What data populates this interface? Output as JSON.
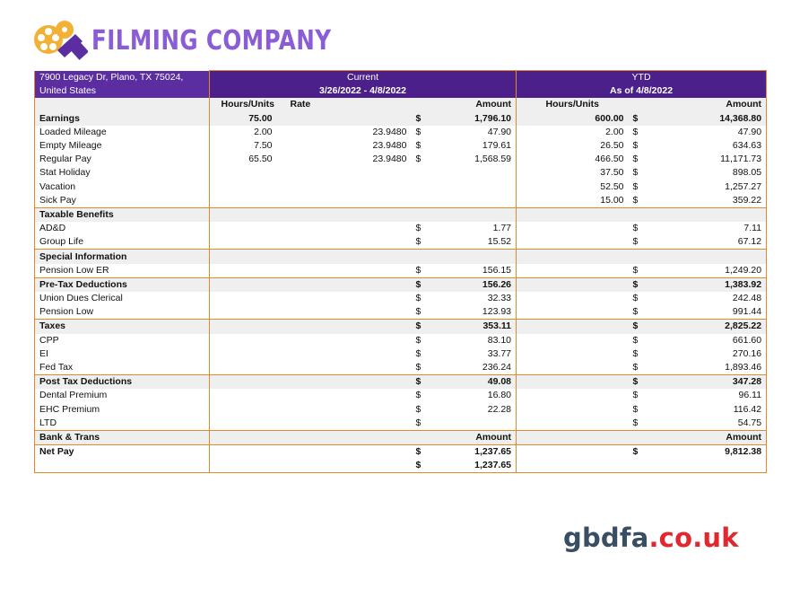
{
  "brand": {
    "name": "FILMING COMPANY",
    "color": "#8a5cd6",
    "icon": "film-reel-icon"
  },
  "header": {
    "address": "7900  Legacy Dr, Plano, TX 75024, United States",
    "current_label": "Current",
    "current_period": "3/26/2022  - 4/8/2022",
    "ytd_label": "YTD",
    "ytd_period": "As of 4/8/2022"
  },
  "columns": [
    "Hours/Units",
    "Rate",
    "Amount",
    "Hours/Units",
    "Amount"
  ],
  "rows": [
    {
      "label": "Earnings",
      "hours": "75.00",
      "rate": "",
      "cur_dollar": "$",
      "cur_amount": "1,796.10",
      "ytd_hours": "600.00",
      "ytd_dollar": "$",
      "ytd_amount": "14,368.80",
      "bold": true,
      "grey": true
    },
    {
      "label": "Loaded Mileage",
      "hours": "2.00",
      "rate": "23.9480",
      "cur_dollar": "$",
      "cur_amount": "47.90",
      "ytd_hours": "2.00",
      "ytd_dollar": "$",
      "ytd_amount": "47.90"
    },
    {
      "label": "Empty Mileage",
      "hours": "7.50",
      "rate": "23.9480",
      "cur_dollar": "$",
      "cur_amount": "179.61",
      "ytd_hours": "26.50",
      "ytd_dollar": "$",
      "ytd_amount": "634.63"
    },
    {
      "label": "Regular Pay",
      "hours": "65.50",
      "rate": "23.9480",
      "cur_dollar": "$",
      "cur_amount": "1,568.59",
      "ytd_hours": "466.50",
      "ytd_dollar": "$",
      "ytd_amount": "11,171.73"
    },
    {
      "label": "Stat Holiday",
      "hours": "",
      "rate": "",
      "cur_dollar": "",
      "cur_amount": "",
      "ytd_hours": "37.50",
      "ytd_dollar": "$",
      "ytd_amount": "898.05"
    },
    {
      "label": "Vacation",
      "hours": "",
      "rate": "",
      "cur_dollar": "",
      "cur_amount": "",
      "ytd_hours": "52.50",
      "ytd_dollar": "$",
      "ytd_amount": "1,257.27"
    },
    {
      "label": "Sick Pay",
      "hours": "",
      "rate": "",
      "cur_dollar": "",
      "cur_amount": "",
      "ytd_hours": "15.00",
      "ytd_dollar": "$",
      "ytd_amount": "359.22"
    },
    {
      "label": "Taxable Benefits",
      "hours": "",
      "rate": "",
      "cur_dollar": "",
      "cur_amount": "",
      "ytd_hours": "",
      "ytd_dollar": "",
      "ytd_amount": "",
      "bold": true,
      "grey": true,
      "line": true
    },
    {
      "label": "AD&D",
      "hours": "",
      "rate": "",
      "cur_dollar": "$",
      "cur_amount": "1.77",
      "ytd_hours": "",
      "ytd_dollar": "$",
      "ytd_amount": "7.11"
    },
    {
      "label": "Group Life",
      "hours": "",
      "rate": "",
      "cur_dollar": "$",
      "cur_amount": "15.52",
      "ytd_hours": "",
      "ytd_dollar": "$",
      "ytd_amount": "67.12"
    },
    {
      "label": "Special Information",
      "hours": "",
      "rate": "",
      "cur_dollar": "",
      "cur_amount": "",
      "ytd_hours": "",
      "ytd_dollar": "",
      "ytd_amount": "",
      "bold": true,
      "grey": true,
      "line": true
    },
    {
      "label": "Pension Low ER",
      "hours": "",
      "rate": "",
      "cur_dollar": "$",
      "cur_amount": "156.15",
      "ytd_hours": "",
      "ytd_dollar": "$",
      "ytd_amount": "1,249.20"
    },
    {
      "label": "Pre-Tax Deductions",
      "hours": "",
      "rate": "",
      "cur_dollar": "$",
      "cur_amount": "156.26",
      "ytd_hours": "",
      "ytd_dollar": "$",
      "ytd_amount": "1,383.92",
      "bold": true,
      "grey": true,
      "line": true
    },
    {
      "label": "Union Dues Clerical",
      "hours": "",
      "rate": "",
      "cur_dollar": "$",
      "cur_amount": "32.33",
      "ytd_hours": "",
      "ytd_dollar": "$",
      "ytd_amount": "242.48"
    },
    {
      "label": "Pension Low",
      "hours": "",
      "rate": "",
      "cur_dollar": "$",
      "cur_amount": "123.93",
      "ytd_hours": "",
      "ytd_dollar": "$",
      "ytd_amount": "991.44"
    },
    {
      "label": "Taxes",
      "hours": "",
      "rate": "",
      "cur_dollar": "$",
      "cur_amount": "353.11",
      "ytd_hours": "",
      "ytd_dollar": "$",
      "ytd_amount": "2,825.22",
      "bold": true,
      "grey": true,
      "line": true
    },
    {
      "label": "CPP",
      "hours": "",
      "rate": "",
      "cur_dollar": "$",
      "cur_amount": "83.10",
      "ytd_hours": "",
      "ytd_dollar": "$",
      "ytd_amount": "661.60"
    },
    {
      "label": "EI",
      "hours": "",
      "rate": "",
      "cur_dollar": "$",
      "cur_amount": "33.77",
      "ytd_hours": "",
      "ytd_dollar": "$",
      "ytd_amount": "270.16"
    },
    {
      "label": "Fed Tax",
      "hours": "",
      "rate": "",
      "cur_dollar": "$",
      "cur_amount": "236.24",
      "ytd_hours": "",
      "ytd_dollar": "$",
      "ytd_amount": "1,893.46"
    },
    {
      "label": "Post Tax Deductions",
      "hours": "",
      "rate": "",
      "cur_dollar": "$",
      "cur_amount": "49.08",
      "ytd_hours": "",
      "ytd_dollar": "$",
      "ytd_amount": "347.28",
      "bold": true,
      "grey": true,
      "line": true
    },
    {
      "label": "Dental Premium",
      "hours": "",
      "rate": "",
      "cur_dollar": "$",
      "cur_amount": "16.80",
      "ytd_hours": "",
      "ytd_dollar": "$",
      "ytd_amount": "96.11"
    },
    {
      "label": "EHC Premium",
      "hours": "",
      "rate": "",
      "cur_dollar": "$",
      "cur_amount": "22.28",
      "ytd_hours": "",
      "ytd_dollar": "$",
      "ytd_amount": "116.42"
    },
    {
      "label": "LTD",
      "hours": "",
      "rate": "",
      "cur_dollar": "$",
      "cur_amount": "",
      "ytd_hours": "",
      "ytd_dollar": "$",
      "ytd_amount": "54.75"
    },
    {
      "label": "Bank & Trans",
      "hours": "",
      "rate": "",
      "cur_dollar": "",
      "cur_amount": "Amount",
      "ytd_hours": "",
      "ytd_dollar": "",
      "ytd_amount": "Amount",
      "bold": true,
      "grey": true,
      "line": true
    },
    {
      "label": "Net Pay",
      "hours": "",
      "rate": "",
      "cur_dollar": "$",
      "cur_amount": "1,237.65",
      "ytd_hours": "",
      "ytd_dollar": "$",
      "ytd_amount": "9,812.38",
      "bold": true,
      "line": true
    },
    {
      "label": "",
      "hours": "",
      "rate": "",
      "cur_dollar": "$",
      "cur_amount": "1,237.65",
      "ytd_hours": "",
      "ytd_dollar": "",
      "ytd_amount": "",
      "bold": true,
      "last": true
    }
  ],
  "watermark": {
    "main": "gbdfa",
    "domain": ".co.uk"
  },
  "colors": {
    "header_purple": "#4b208a",
    "accent_orange": "#e08a2a",
    "section_grey": "#efefef"
  }
}
